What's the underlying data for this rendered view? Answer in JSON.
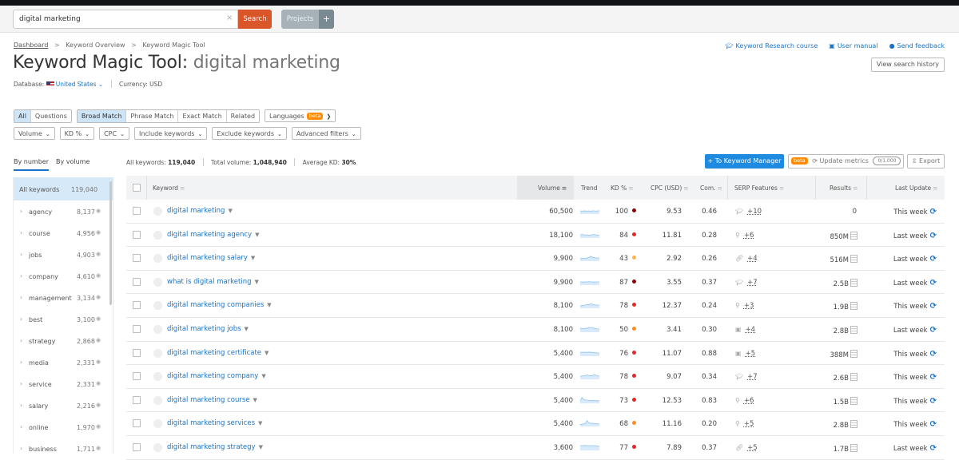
{
  "search": {
    "value": "digital marketing",
    "clear_icon": "×",
    "search_label": "Search",
    "projects_label": "Projects",
    "projects_plus": "+"
  },
  "breadcrumb": {
    "items": [
      "Dashboard",
      "Keyword Overview",
      "Keyword Magic Tool"
    ],
    "separator": ">"
  },
  "header": {
    "title_prefix": "Keyword Magic Tool:",
    "title_keyword": "digital marketing",
    "database_label": "Database:",
    "database_value": "United States",
    "currency_label": "Currency: USD"
  },
  "toplinks": {
    "course": "Keyword Research course",
    "manual": "User manual",
    "feedback": "Send feedback",
    "history": "View search history"
  },
  "filters": {
    "type_tabs": [
      "All",
      "Questions"
    ],
    "match_tabs": [
      "Broad Match",
      "Phrase Match",
      "Exact Match",
      "Related"
    ],
    "languages": "Languages",
    "beta": "beta",
    "dropdowns": [
      "Volume",
      "KD %",
      "CPC",
      "Include keywords",
      "Exclude keywords",
      "Advanced filters"
    ]
  },
  "sidebar": {
    "tabs": [
      "By number",
      "By volume"
    ],
    "all_label": "All keywords",
    "all_count": "119,040",
    "groups": [
      {
        "label": "agency",
        "count": "8,137"
      },
      {
        "label": "course",
        "count": "4,956"
      },
      {
        "label": "jobs",
        "count": "4,903"
      },
      {
        "label": "company",
        "count": "4,610"
      },
      {
        "label": "management",
        "count": "3,134"
      },
      {
        "label": "best",
        "count": "3,100"
      },
      {
        "label": "strategy",
        "count": "2,868"
      },
      {
        "label": "media",
        "count": "2,331"
      },
      {
        "label": "service",
        "count": "2,331"
      },
      {
        "label": "salary",
        "count": "2,216"
      },
      {
        "label": "online",
        "count": "1,970"
      },
      {
        "label": "business",
        "count": "1,711"
      }
    ]
  },
  "summary": {
    "all_keywords_label": "All keywords:",
    "all_keywords_value": "119,040",
    "total_volume_label": "Total volume:",
    "total_volume_value": "1,048,940",
    "avg_kd_label": "Average KD:",
    "avg_kd_value": "30%"
  },
  "actions": {
    "to_keyword_manager": "+ To Keyword Manager",
    "beta": "beta",
    "update_metrics": "Update metrics",
    "quota": "0/1,000",
    "export": "Export"
  },
  "table": {
    "headers": {
      "keyword": "Keyword",
      "volume": "Volume",
      "trend": "Trend",
      "kd": "KD %",
      "cpc": "CPC (USD)",
      "com": "Com.",
      "serp": "SERP Features",
      "results": "Results",
      "last_update": "Last Update"
    },
    "kd_colors": {
      "very_hard": "#8b0000",
      "hard": "#e8262a",
      "difficult": "#ff8c1a",
      "possible": "#fdb44b"
    },
    "rows": [
      {
        "keyword": "digital marketing",
        "volume": "60,500",
        "kd": "100",
        "kd_level": "very_hard",
        "cpc": "9.53",
        "com": "0.46",
        "serp_icon": "graduation-cap",
        "serp_more": "+10",
        "results": "0",
        "results_icon": false,
        "last_update": "This week",
        "trend": [
          0.5,
          0.45,
          0.5,
          0.48,
          0.45,
          0.5,
          0.42,
          0.5,
          0.5,
          0.45,
          0.5,
          0.5
        ]
      },
      {
        "keyword": "digital marketing agency",
        "volume": "18,100",
        "kd": "84",
        "kd_level": "hard",
        "cpc": "11.81",
        "com": "0.28",
        "serp_icon": "map-pin",
        "serp_more": "+6",
        "results": "850M",
        "results_icon": true,
        "last_update": "Last week",
        "trend": [
          0.5,
          0.55,
          0.5,
          0.45,
          0.5,
          0.4,
          0.45,
          0.5,
          0.55,
          0.5,
          0.45,
          0.5
        ]
      },
      {
        "keyword": "digital marketing salary",
        "volume": "9,900",
        "kd": "43",
        "kd_level": "possible",
        "cpc": "2.92",
        "com": "0.26",
        "serp_icon": "link",
        "serp_more": "+4",
        "results": "516M",
        "results_icon": true,
        "last_update": "Last week",
        "trend": [
          0.4,
          0.4,
          0.45,
          0.4,
          0.5,
          0.6,
          0.75,
          0.6,
          0.55,
          0.5,
          0.5,
          0.5
        ]
      },
      {
        "keyword": "what is digital marketing",
        "volume": "9,900",
        "kd": "87",
        "kd_level": "very_hard",
        "cpc": "3.55",
        "com": "0.37",
        "serp_icon": "graduation-cap",
        "serp_more": "+7",
        "results": "2.5B",
        "results_icon": true,
        "last_update": "Last week",
        "trend": [
          0.5,
          0.5,
          0.48,
          0.5,
          0.5,
          0.55,
          0.5,
          0.5,
          0.48,
          0.5,
          0.5,
          0.5
        ]
      },
      {
        "keyword": "digital marketing companies",
        "volume": "8,100",
        "kd": "78",
        "kd_level": "hard",
        "cpc": "12.37",
        "com": "0.24",
        "serp_icon": "map-pin",
        "serp_more": "+3",
        "results": "1.9B",
        "results_icon": true,
        "last_update": "This week",
        "trend": [
          0.4,
          0.4,
          0.45,
          0.5,
          0.6,
          0.55,
          0.7,
          0.6,
          0.55,
          0.5,
          0.5,
          0.5
        ]
      },
      {
        "keyword": "digital marketing jobs",
        "volume": "8,100",
        "kd": "50",
        "kd_level": "difficult",
        "cpc": "3.41",
        "com": "0.30",
        "serp_icon": "image",
        "serp_more": "+4",
        "results": "2.8B",
        "results_icon": true,
        "last_update": "Last week",
        "trend": [
          0.6,
          0.6,
          0.55,
          0.6,
          0.6,
          0.75,
          0.7,
          0.75,
          0.6,
          0.55,
          0.5,
          0.5
        ]
      },
      {
        "keyword": "digital marketing certificate",
        "volume": "5,400",
        "kd": "76",
        "kd_level": "hard",
        "cpc": "11.07",
        "com": "0.88",
        "serp_icon": "image",
        "serp_more": "+5",
        "results": "388M",
        "results_icon": true,
        "last_update": "This week",
        "trend": [
          0.6,
          0.6,
          0.62,
          0.6,
          0.6,
          0.65,
          0.6,
          0.6,
          0.55,
          0.55,
          0.5,
          0.5
        ]
      },
      {
        "keyword": "digital marketing company",
        "volume": "5,400",
        "kd": "78",
        "kd_level": "hard",
        "cpc": "9.07",
        "com": "0.34",
        "serp_icon": "graduation-cap",
        "serp_more": "+7",
        "results": "2.6B",
        "results_icon": true,
        "last_update": "This week",
        "trend": [
          0.5,
          0.5,
          0.55,
          0.6,
          0.7,
          0.6,
          0.55,
          0.6,
          0.7,
          0.65,
          0.55,
          0.5
        ]
      },
      {
        "keyword": "digital marketing course",
        "volume": "5,400",
        "kd": "73",
        "kd_level": "hard",
        "cpc": "12.53",
        "com": "0.83",
        "serp_icon": "map-pin",
        "serp_more": "+6",
        "results": "1.5B",
        "results_icon": true,
        "last_update": "This week",
        "trend": [
          0.4,
          0.9,
          0.6,
          0.5,
          0.5,
          0.45,
          0.45,
          0.45,
          0.4,
          0.4,
          0.4,
          0.4
        ]
      },
      {
        "keyword": "digital marketing services",
        "volume": "5,400",
        "kd": "68",
        "kd_level": "difficult",
        "cpc": "11.16",
        "com": "0.20",
        "serp_icon": "map-pin",
        "serp_more": "+5",
        "results": "2.8B",
        "results_icon": true,
        "last_update": "This week",
        "trend": [
          0.3,
          0.35,
          0.4,
          0.5,
          0.9,
          0.55,
          0.5,
          0.5,
          0.45,
          0.45,
          0.4,
          0.4
        ]
      },
      {
        "keyword": "digital marketing strategy",
        "volume": "3,600",
        "kd": "77",
        "kd_level": "hard",
        "cpc": "7.89",
        "com": "0.37",
        "serp_icon": "link",
        "serp_more": "+5",
        "results": "1.7B",
        "results_icon": true,
        "last_update": "Last week",
        "trend": [
          0.75,
          0.75,
          0.75,
          0.78,
          0.75,
          0.75,
          0.75,
          0.75,
          0.75,
          0.72,
          0.7,
          0.7
        ]
      }
    ]
  }
}
